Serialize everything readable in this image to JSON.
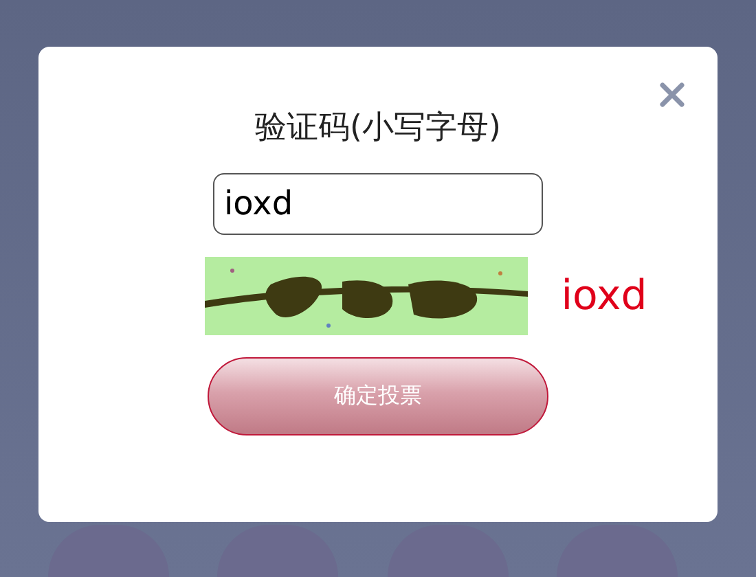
{
  "dialog": {
    "title": "验证码(小写字母)",
    "input": {
      "value": "ioxd"
    },
    "captcha_hint": "ioxd",
    "submit_button": "确定投票"
  }
}
